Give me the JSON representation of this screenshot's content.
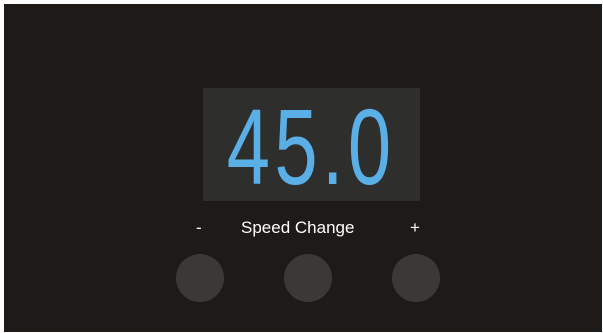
{
  "display": {
    "value": "45.0"
  },
  "controls": {
    "minus_label": "-",
    "title": "Speed Change",
    "plus_label": "+"
  },
  "colors": {
    "panel_background": "#1e1a18",
    "display_background": "#2e2e2c",
    "readout_digits": "#5ab0e6",
    "knob": "#3c3836",
    "label_text": "#ffffff"
  }
}
